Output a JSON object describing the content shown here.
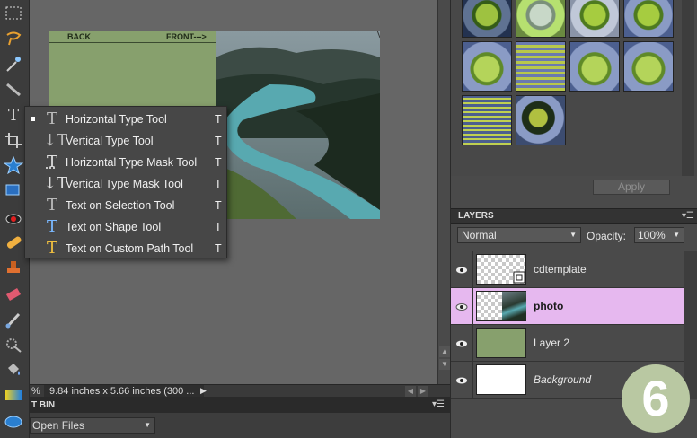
{
  "tool_flyout": {
    "items": [
      {
        "label": "Horizontal Type Tool",
        "shortcut": "T",
        "icon": "type-icon",
        "selected": true
      },
      {
        "label": "Vertical Type Tool",
        "shortcut": "T",
        "icon": "vertical-type-icon"
      },
      {
        "label": "Horizontal Type Mask Tool",
        "shortcut": "T",
        "icon": "type-mask-icon"
      },
      {
        "label": "Vertical Type Mask Tool",
        "shortcut": "T",
        "icon": "vertical-type-mask-icon"
      },
      {
        "label": "Text on Selection Tool",
        "shortcut": "T",
        "icon": "text-on-selection-icon"
      },
      {
        "label": "Text on Shape Tool",
        "shortcut": "T",
        "icon": "text-on-shape-icon"
      },
      {
        "label": "Text on Custom Path Tool",
        "shortcut": "T",
        "icon": "text-on-path-icon"
      }
    ]
  },
  "document": {
    "back_label": "BACK",
    "front_label": "FRONT--->"
  },
  "status_bar": {
    "zoom": "%",
    "info": "9.84 inches x 5.66 inches (300 ..."
  },
  "project_bin": {
    "title": "T BIN",
    "dropdown_value": "Open Files"
  },
  "effects": {
    "apply_label": "Apply"
  },
  "layers": {
    "title": "LAYERS",
    "blend_mode": "Normal",
    "opacity_label": "Opacity:",
    "opacity_value": "100%",
    "items": [
      {
        "name": "cdtemplate"
      },
      {
        "name": "photo",
        "selected": true
      },
      {
        "name": "Layer 2"
      },
      {
        "name": "Background"
      }
    ]
  },
  "step_badge": "6",
  "colors": {
    "selected_layer": "#e6b8ef",
    "doc_green": "#87a06d",
    "badge": "#b9c8a2"
  }
}
